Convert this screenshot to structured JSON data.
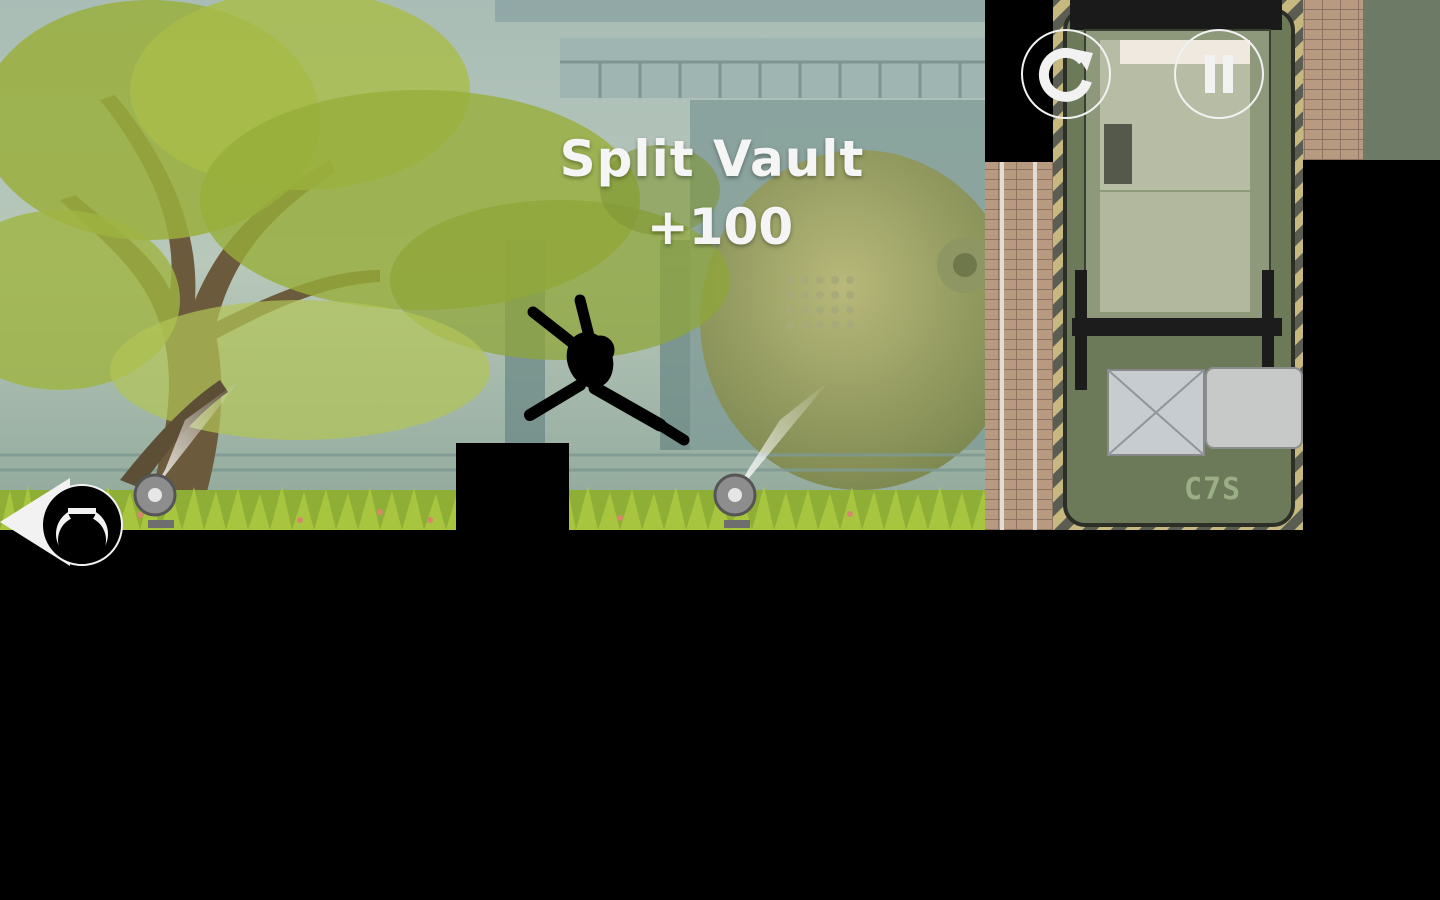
{
  "trick": {
    "name": "Split Vault",
    "points": "+100"
  },
  "truck": {
    "plate": "C7S"
  },
  "hud": {
    "restart_icon": "restart-arrow-icon",
    "pause_icon": "pause-icon",
    "tracker_icon": "hunter-tracker-icon"
  },
  "colors": {
    "sky": "#b9c9bd",
    "foliage": "#9bb33a",
    "grass": "#9fbf3a",
    "ground": "#000000",
    "wall_brick": "#b79b82",
    "truck": "#6f7f5c",
    "hud_white": "#f2f2f2"
  }
}
